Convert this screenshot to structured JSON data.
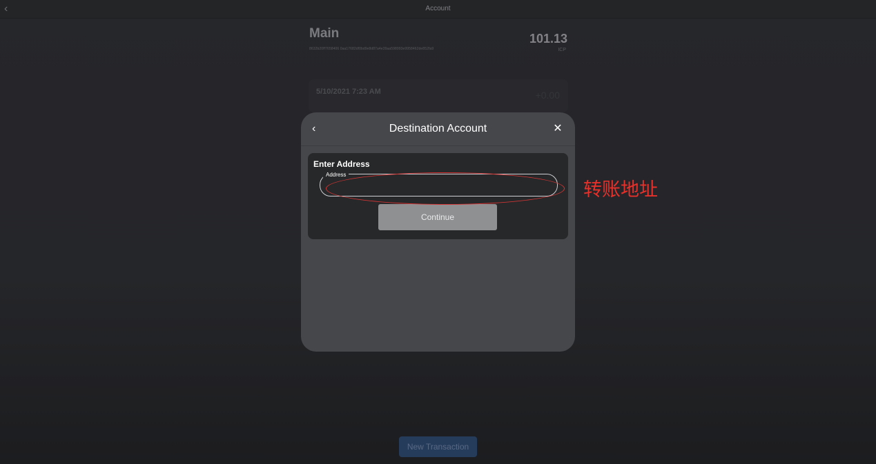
{
  "topbar": {
    "back_icon": "chevron-left-icon",
    "title": "Account"
  },
  "account": {
    "name": "Main",
    "id": "8632b20ff7658406 0aa17682df0bd9e8d87a4e39aa598993e9958462de852fa9",
    "balance": "101.13",
    "currency": "ICP"
  },
  "transactions": [
    {
      "date": "5/10/2021 7:23 AM",
      "amount": "+0.00"
    }
  ],
  "footer": {
    "new_transaction_label": "New Transaction"
  },
  "modal": {
    "title": "Destination Account",
    "back_icon": "chevron-left-icon",
    "close_icon": "close-icon",
    "heading": "Enter Address",
    "address_label": "Address",
    "address_value": "",
    "continue_label": "Continue"
  },
  "annotation": {
    "text": "转账地址",
    "color": "#e8302a"
  }
}
